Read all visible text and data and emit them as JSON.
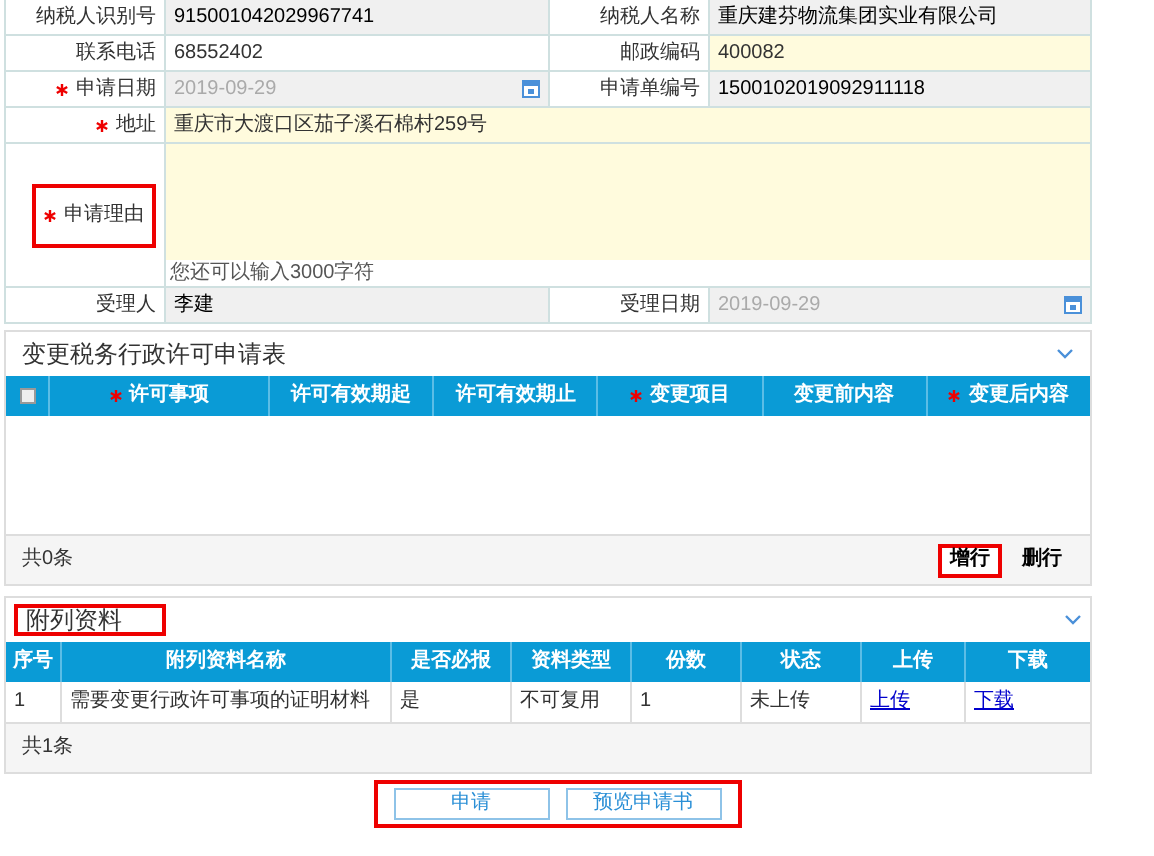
{
  "form": {
    "rows": [
      {
        "fields": [
          {
            "label": "纳税人识别号",
            "required": false,
            "kind": "readonly",
            "value": "915001042029967741"
          },
          {
            "label": "纳税人名称",
            "required": false,
            "kind": "readonly",
            "value": "重庆建芬物流集团实业有限公司"
          }
        ]
      },
      {
        "fields": [
          {
            "label": "联系电话",
            "required": false,
            "kind": "text",
            "value": "68552402"
          },
          {
            "label": "邮政编码",
            "required": false,
            "kind": "input",
            "value": "400082"
          }
        ]
      },
      {
        "fields": [
          {
            "label": "申请日期",
            "required": true,
            "kind": "date",
            "value": "2019-09-29"
          },
          {
            "label": "申请单编号",
            "required": false,
            "kind": "readonly",
            "value": "1500102019092911118"
          }
        ]
      },
      {
        "fields": [
          {
            "label": "地址",
            "required": true,
            "kind": "input",
            "value": "重庆市大渡口区茄子溪石棉村259号"
          }
        ]
      },
      {
        "fields": [
          {
            "label": "申请理由",
            "required": true,
            "kind": "textarea",
            "highlighted": true,
            "hint": "您还可以输入3000字符"
          }
        ]
      },
      {
        "fields": [
          {
            "label": "受理人",
            "required": false,
            "kind": "readonly",
            "value": "李建"
          },
          {
            "label": "受理日期",
            "required": false,
            "kind": "date",
            "value": "2019-09-29"
          }
        ]
      }
    ]
  },
  "permit_section": {
    "title": "变更税务行政许可申请表",
    "expanded": true,
    "select_all": {
      "checked": false
    },
    "columns": [
      {
        "label": "许可事项",
        "required": true
      },
      {
        "label": "许可有效期起",
        "required": false
      },
      {
        "label": "许可有效期止",
        "required": false
      },
      {
        "label": "变更项目",
        "required": true
      },
      {
        "label": "变更前内容",
        "required": false
      },
      {
        "label": "变更后内容",
        "required": true
      }
    ],
    "total": "共0条",
    "buttons": [
      {
        "label": "增行",
        "highlighted": true
      },
      {
        "label": "删行",
        "highlighted": false
      }
    ]
  },
  "attachment_section": {
    "title": "附列资料",
    "highlighted": true,
    "expanded": true,
    "columns": [
      "序号",
      "附列资料名称",
      "是否必报",
      "资料类型",
      "份数",
      "状态",
      "上传",
      "下载"
    ],
    "rows": [
      {
        "cells": [
          {
            "kind": "text",
            "text": "1"
          },
          {
            "kind": "text",
            "text": "需要变更行政许可事项的证明材料"
          },
          {
            "kind": "text",
            "text": "是"
          },
          {
            "kind": "text",
            "text": "不可复用"
          },
          {
            "kind": "text",
            "text": "1"
          },
          {
            "kind": "text",
            "text": "未上传"
          },
          {
            "kind": "link",
            "text": "上传"
          },
          {
            "kind": "link",
            "text": "下载"
          }
        ]
      }
    ],
    "total": "共1条"
  },
  "actions": {
    "highlighted": true,
    "buttons": [
      "申请",
      "预览申请书"
    ]
  }
}
